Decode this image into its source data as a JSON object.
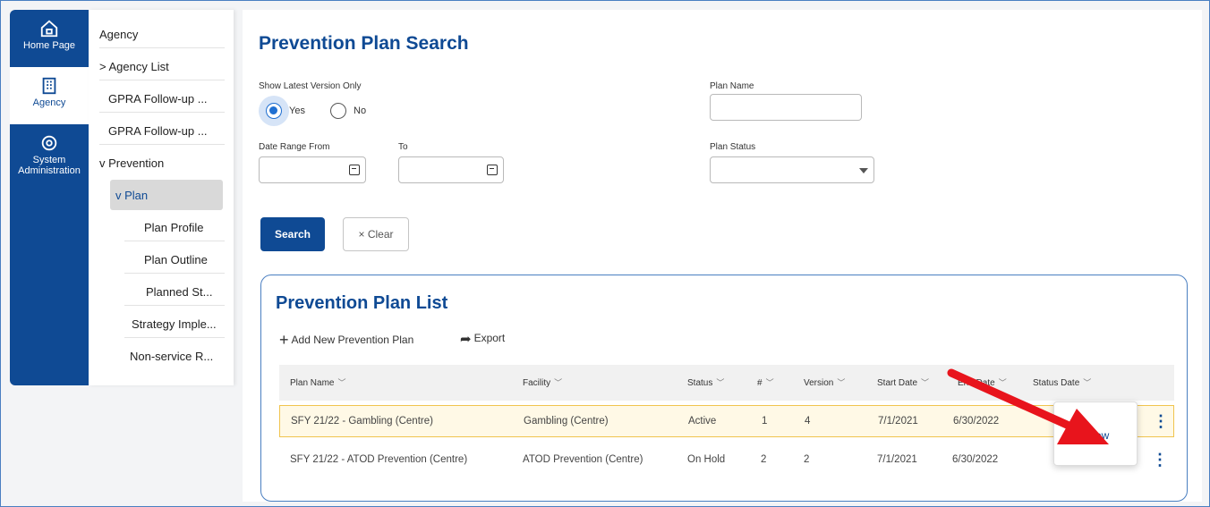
{
  "rail": {
    "items": [
      {
        "label": "Home Page",
        "icon": "home-icon"
      },
      {
        "label": "Agency",
        "icon": "building-icon"
      },
      {
        "label": "System Administration",
        "icon": "gear-icon"
      }
    ]
  },
  "subnav": {
    "items": [
      "Agency",
      "> Agency List",
      "GPRA Follow-up ...",
      "GPRA Follow-up ...",
      "v Prevention",
      "v Plan",
      "Plan Profile",
      "Plan Outline",
      "Planned St...",
      "Strategy Imple...",
      "Non-service R..."
    ]
  },
  "search": {
    "title": "Prevention Plan Search",
    "show_latest_label": "Show Latest Version Only",
    "yes_label": "Yes",
    "no_label": "No",
    "date_from_label": "Date Range From",
    "to_label": "To",
    "plan_name_label": "Plan Name",
    "plan_status_label": "Plan Status",
    "search_button": "Search",
    "clear_button": "× Clear"
  },
  "list": {
    "title": "Prevention Plan List",
    "add_label": "Add New Prevention Plan",
    "export_label": "Export",
    "columns": [
      "Plan Name",
      "Facility",
      "Status",
      "#",
      "Version",
      "Start Date",
      "End Date",
      "Status Date"
    ],
    "rows": [
      {
        "plan_name": "SFY 21/22 - Gambling (Centre)",
        "facility": "Gambling (Centre)",
        "status": "Active",
        "num": "1",
        "version": "4",
        "start": "7/1/2021",
        "end": "6/30/2022"
      },
      {
        "plan_name": "SFY 21/22 - ATOD Prevention (Centre)",
        "facility": "ATOD Prevention (Centre)",
        "status": "On Hold",
        "num": "2",
        "version": "2",
        "start": "7/1/2021",
        "end": "6/30/2022"
      }
    ],
    "menu_item": "Review"
  },
  "colors": {
    "brand": "#0f4a94",
    "highlight_row": "#fff9e6",
    "arrow": "#e8141c"
  }
}
